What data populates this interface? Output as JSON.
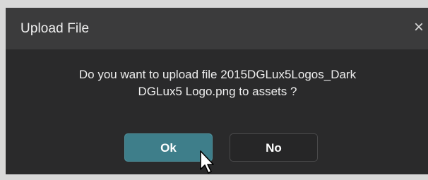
{
  "dialog": {
    "title": "Upload File",
    "close_glyph": "×",
    "message_line1": "Do you want to upload file 2015DGLux5Logos_Dark",
    "message_line2": "DGLux5 Logo.png to assets ?",
    "ok_label": "Ok",
    "no_label": "No"
  },
  "colors": {
    "title_bar": "#3b3b3c",
    "body": "#2a2a2b",
    "ok_button": "#3e7e8a",
    "no_button": "#262627"
  },
  "icons": {
    "close": "close-icon",
    "cursor": "mouse-cursor-icon"
  }
}
